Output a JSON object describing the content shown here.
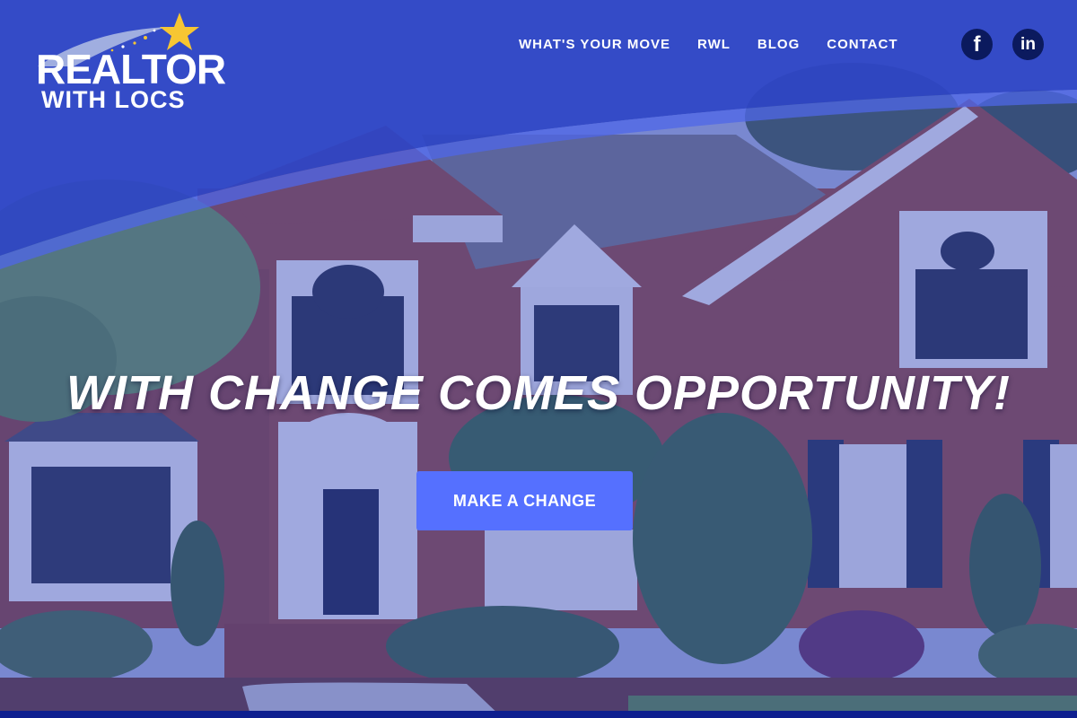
{
  "brand": {
    "line1": "REALTOR",
    "line2": "WITH LOCS",
    "star_color": "#f7c632"
  },
  "nav": {
    "items": [
      {
        "label": "WHAT'S YOUR MOVE"
      },
      {
        "label": "RWL"
      },
      {
        "label": "BLOG"
      },
      {
        "label": "CONTACT"
      }
    ]
  },
  "social": {
    "facebook": "f",
    "linkedin": "in"
  },
  "hero": {
    "headline": "WITH CHANGE COMES OPPORTUNITY!",
    "cta_label": "MAKE A CHANGE"
  },
  "colors": {
    "overlay": "#2f45c6",
    "button": "#5570ff",
    "icon_bg": "#0b1a5e"
  }
}
